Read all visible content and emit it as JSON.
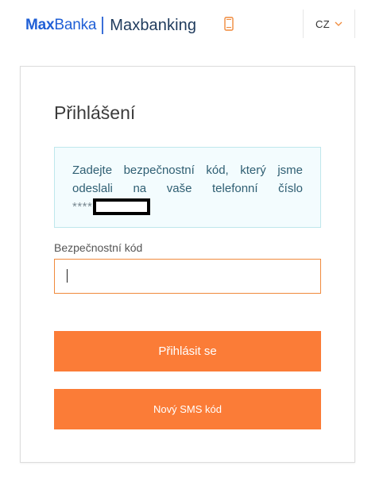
{
  "header": {
    "logo_max": "Max",
    "logo_banka": "Banka",
    "logo_product": "Maxbanking",
    "phone_icon": "mobile-phone-icon",
    "language": "CZ",
    "language_icon": "chevron-down-icon"
  },
  "login": {
    "title": "Přihlášení",
    "info_line1": "Zadejte bezpečnostní kód, který jsme",
    "info_line2": "odeslali na vaše telefonní číslo",
    "info_masked": "****",
    "code_label": "Bezpečnostní kód",
    "code_value": "",
    "submit_label": "Přihlásit se",
    "resend_label": "Nový SMS kód"
  },
  "colors": {
    "brand_blue": "#1f5fd6",
    "accent_orange": "#fb7c37",
    "info_bg": "#f3fcfe",
    "info_border": "#bfe7ec"
  }
}
